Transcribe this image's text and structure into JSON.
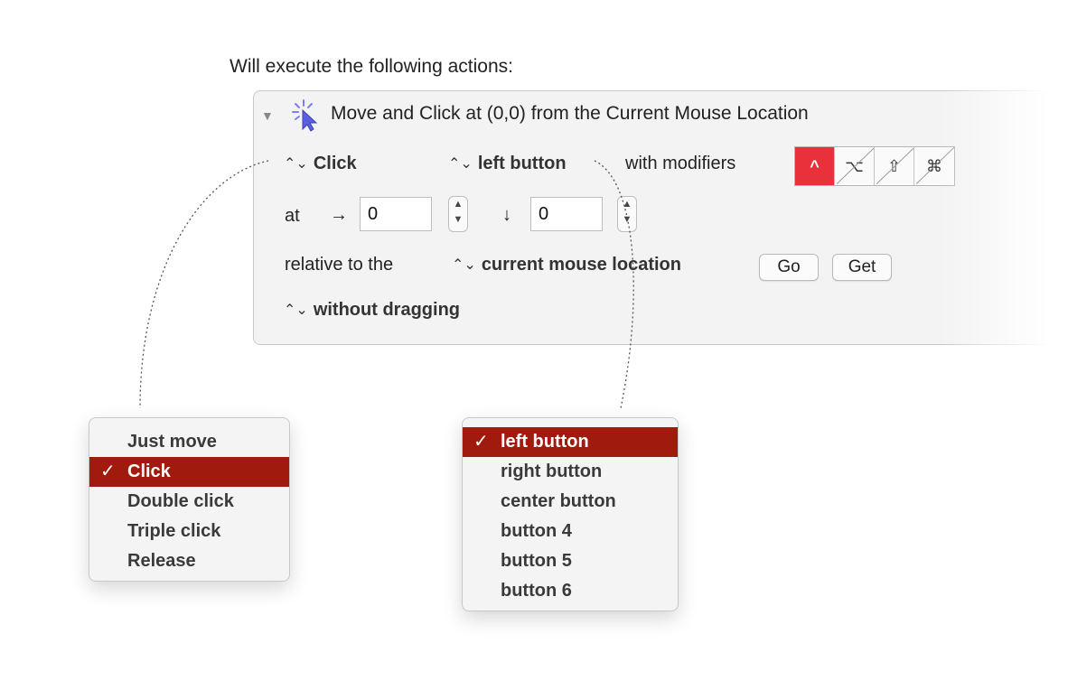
{
  "heading": "Will execute the following actions:",
  "action": {
    "title": "Move and Click at (0,0) from the Current Mouse Location",
    "click_popup": "Click",
    "button_popup": "left button",
    "with_modifiers_label": "with modifiers",
    "modifiers": [
      {
        "name": "control",
        "glyph": "^",
        "active": true
      },
      {
        "name": "option",
        "glyph": "⌥",
        "active": false
      },
      {
        "name": "shift",
        "glyph": "⇧",
        "active": false
      },
      {
        "name": "command",
        "glyph": "⌘",
        "active": false
      }
    ],
    "at_label": "at",
    "x_arrow": "→",
    "x_value": "0",
    "y_arrow": "↓",
    "y_value": "0",
    "relative_label": "relative to the",
    "relative_popup": "current mouse location",
    "go_button": "Go",
    "get_button": "Get",
    "drag_popup": "without dragging"
  },
  "click_menu": {
    "items": [
      "Just move",
      "Click",
      "Double click",
      "Triple click",
      "Release"
    ],
    "selected": "Click"
  },
  "button_menu": {
    "items": [
      "left button",
      "right button",
      "center button",
      "button 4",
      "button 5",
      "button 6"
    ],
    "selected": "left button"
  },
  "colors": {
    "selection": "#a01a0e",
    "modifier_active": "#e8313b",
    "action_icon": "#7b7ff5"
  },
  "icons": {
    "disclosure": "disclosure-triangle-icon",
    "action": "mouse-click-icon",
    "popup": "up-down-chevron-icon",
    "check": "checkmark-icon"
  }
}
